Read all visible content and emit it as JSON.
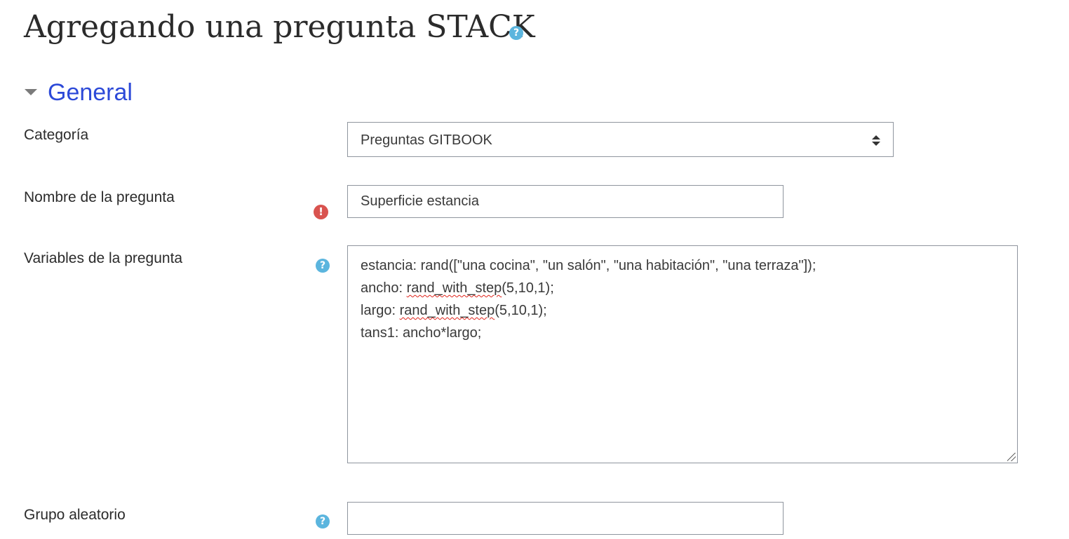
{
  "page": {
    "title": "Agregando una pregunta STACK",
    "title_help_icon": "question-circle-icon"
  },
  "section": {
    "title": "General",
    "toggle_icon": "caret-down-icon"
  },
  "fields": {
    "category": {
      "label": "Categoría",
      "selected": "Preguntas GITBOOK"
    },
    "question_name": {
      "label": "Nombre de la pregunta",
      "value": "Superficie estancia",
      "required_icon": "exclamation-circle-icon"
    },
    "question_variables": {
      "label": "Variables de la pregunta",
      "help_icon": "question-circle-icon",
      "lines": [
        {
          "parts": [
            {
              "text": "estancia: rand([\"una cocina\", \"un salón\", \"una habitación\", \"una terraza\"]);",
              "misspelled": false
            }
          ]
        },
        {
          "parts": [
            {
              "text": "ancho: ",
              "misspelled": false
            },
            {
              "text": "rand_with_step",
              "misspelled": true
            },
            {
              "text": "(5,10,1);",
              "misspelled": false
            }
          ]
        },
        {
          "parts": [
            {
              "text": "largo: ",
              "misspelled": false
            },
            {
              "text": "rand_with_step",
              "misspelled": true
            },
            {
              "text": "(5,10,1);",
              "misspelled": false
            }
          ]
        },
        {
          "parts": [
            {
              "text": "tans1: ancho*largo;",
              "misspelled": false
            }
          ]
        }
      ]
    },
    "random_group": {
      "label": "Grupo aleatorio",
      "value": "",
      "help_icon": "question-circle-icon"
    }
  },
  "colors": {
    "section_title": "#2c49d8",
    "help_icon": "#5bb5de",
    "error_icon": "#d9534f",
    "spellcheck_underline": "#e0241b"
  }
}
